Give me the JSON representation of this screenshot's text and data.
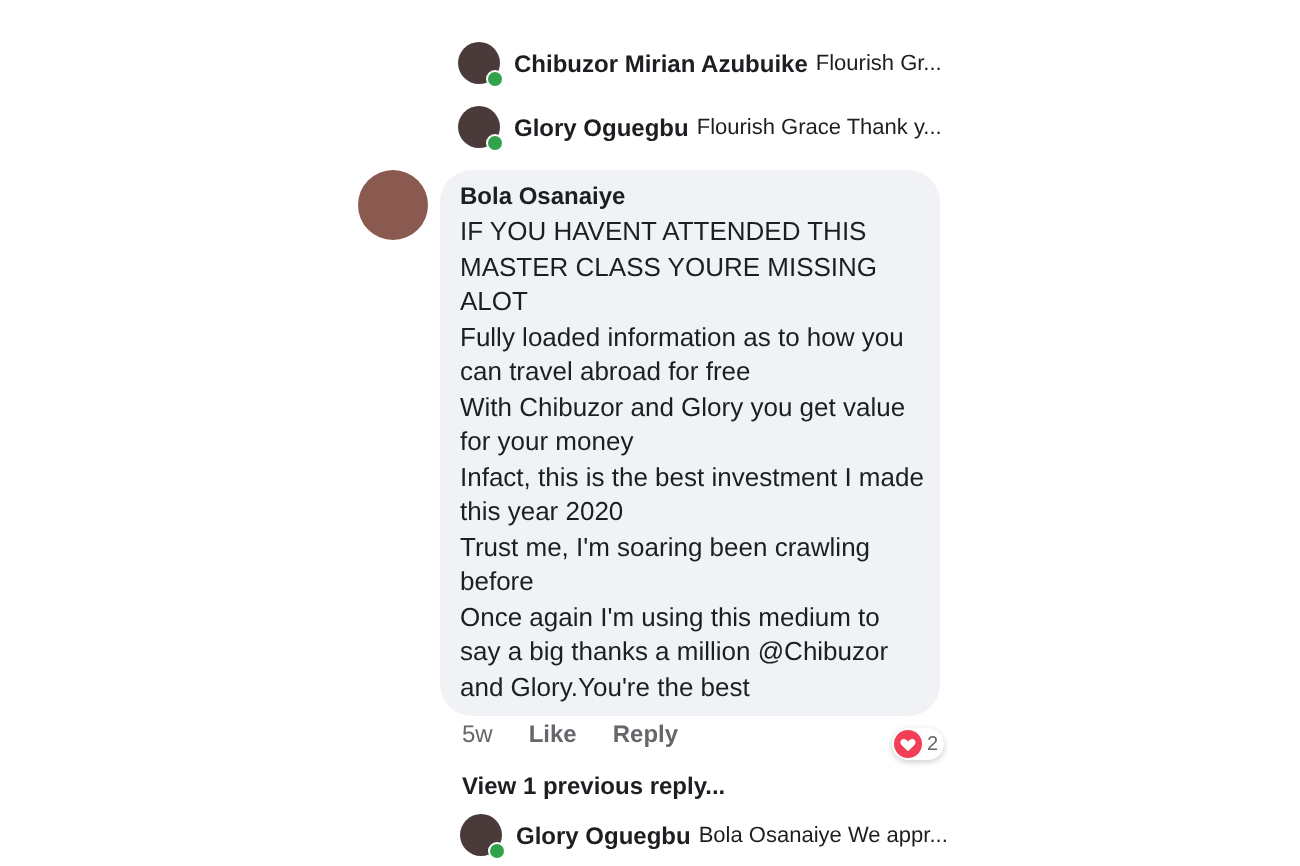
{
  "top_replies": [
    {
      "author": "Chibuzor Mirian Azubuike",
      "text": "Flourish Gr...",
      "online": true
    },
    {
      "author": "Glory Oguegbu",
      "text": "Flourish Grace Thank y...",
      "online": true
    }
  ],
  "comment": {
    "author": "Bola Osanaiye",
    "paragraphs": [
      "IF YOU HAVENT ATTENDED THIS MASTER CLASS YOURE MISSING ALOT",
      "Fully loaded information as to how you can travel abroad for free",
      "With Chibuzor and Glory you get value for your money",
      "Infact, this is the best investment I made this year 2020",
      "Trust me, I'm soaring been crawling before",
      "Once again I'm using this medium to say a big thanks a million @Chibuzor and Glory.You're the best"
    ],
    "time": "5w",
    "actions": [
      "Like",
      "Reply"
    ],
    "reaction_count": "2"
  },
  "view_previous": "View 1 previous reply...",
  "bottom_replies": [
    {
      "author": "Glory Oguegbu",
      "text": "Bola Osanaiye We appr...",
      "online": true
    }
  ]
}
